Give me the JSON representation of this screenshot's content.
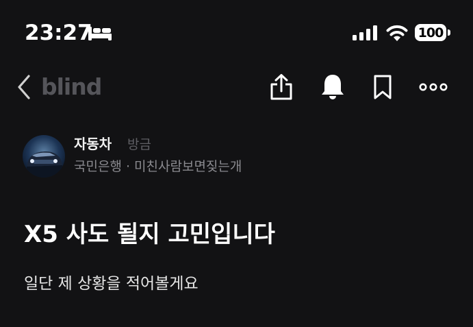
{
  "status_bar": {
    "time": "23:27",
    "battery_level": "100",
    "icons": [
      "bed-icon",
      "signal-icon",
      "wifi-icon",
      "battery-icon"
    ]
  },
  "nav": {
    "logo_text": "blind",
    "icons": [
      "back-icon",
      "share-icon",
      "bell-icon",
      "bookmark-icon",
      "more-icon"
    ]
  },
  "author": {
    "name": "자동차",
    "time": "방금",
    "meta": "국민은행 · 미친사람보면짖는개"
  },
  "post": {
    "title": "X5 사도 될지 고민입니다",
    "body": "일단 제 상황을 적어볼게요"
  },
  "colors": {
    "background": "#121214",
    "logo": "#55555a",
    "muted_text": "#8a8a8f",
    "time_text": "#5f5f64"
  }
}
